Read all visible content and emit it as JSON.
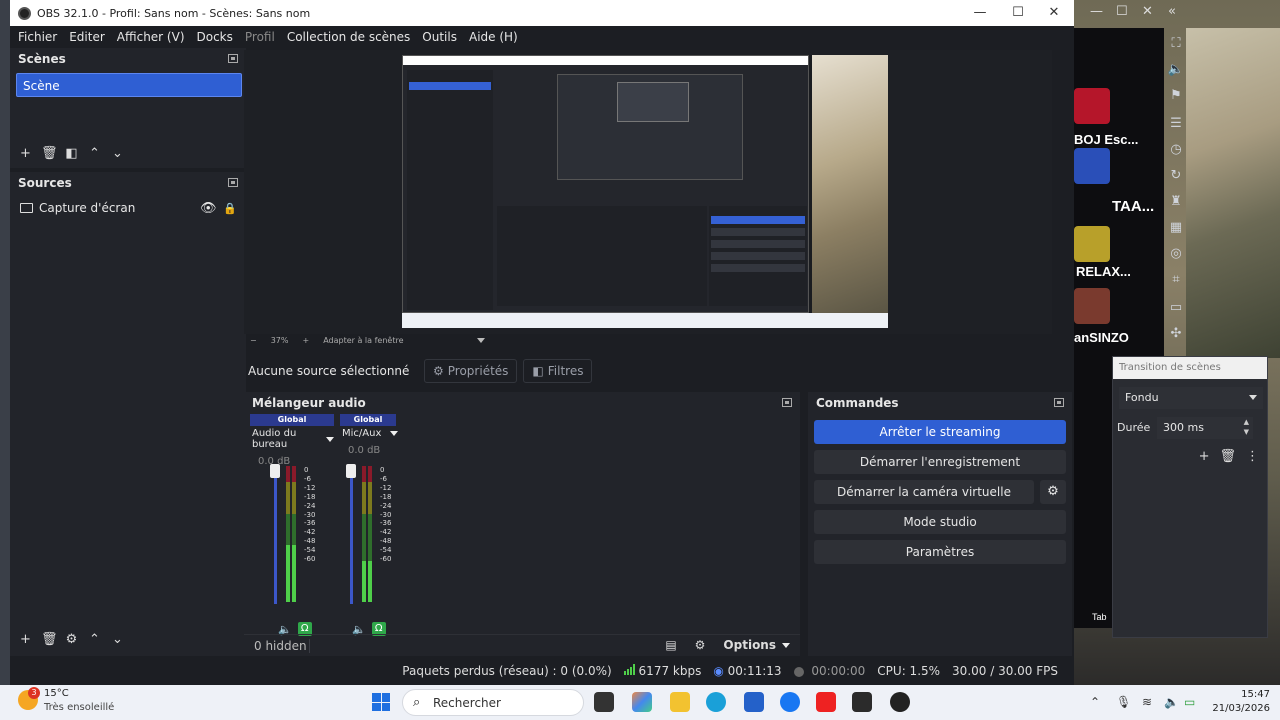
{
  "window": {
    "title": "OBS 32.1.0 - Profil: Sans nom - Scènes: Sans nom",
    "controls": [
      "—",
      "☐",
      "✕"
    ]
  },
  "menu": [
    "Fichier",
    "Editer",
    "Afficher (V)",
    "Docks",
    "Profil",
    "Collection de scènes",
    "Outils",
    "Aide (H)"
  ],
  "scenes": {
    "title": "Scènes",
    "items": [
      "Scène"
    ]
  },
  "sources": {
    "title": "Sources",
    "items": [
      "Capture d'écran"
    ]
  },
  "preview": {
    "zoom": "37%",
    "fit": "Adapter à la fenêtre"
  },
  "context": {
    "no_source": "Aucune source sélectionné",
    "properties": "Propriétés",
    "filters": "Filtres"
  },
  "mixer": {
    "title": "Mélangeur audio",
    "channels": [
      {
        "tag": "Global",
        "name": "Audio du bureau",
        "db": "0.0 dB",
        "level": 0.42
      },
      {
        "tag": "Global",
        "name": "Mic/Aux",
        "db": "0.0 dB",
        "level": 0.3
      }
    ],
    "scale": [
      "0",
      "-6",
      "-12",
      "-18",
      "-24",
      "-30",
      "-36",
      "-42",
      "-48",
      "-54",
      "-60"
    ],
    "hidden": "0 hidden",
    "options": "Options"
  },
  "commands": {
    "title": "Commandes",
    "buttons": [
      "Arrêter le streaming",
      "Démarrer l'enregistrement",
      "Démarrer la caméra virtuelle",
      "Mode studio",
      "Paramètres"
    ]
  },
  "transition": {
    "title": "Transition de scènes",
    "type": "Fondu",
    "duration_label": "Durée",
    "duration": "300 ms"
  },
  "status": {
    "dropped": "Paquets perdus (réseau) : 0 (0.0%)",
    "bitrate": "6177 kbps",
    "stream_time": "00:11:13",
    "rec_time": "00:00:00",
    "cpu": "CPU: 1.5%",
    "fps": "30.00 / 30.00 FPS"
  },
  "taskbar": {
    "temp": "15°C",
    "weather": "Très ensoleillé",
    "badge": "3",
    "search": "Rechercher",
    "time": "15:47",
    "date": "21/03/2026"
  },
  "background": {
    "tags": [
      "BOJ Esc...",
      "TAA...",
      "RELAX...",
      "anSINZO",
      "Tab"
    ]
  },
  "colors": {
    "accent": "#2f5fd3",
    "panel": "#22242a",
    "bg": "#1c1e23",
    "meter_green": "#4fcf4a"
  }
}
